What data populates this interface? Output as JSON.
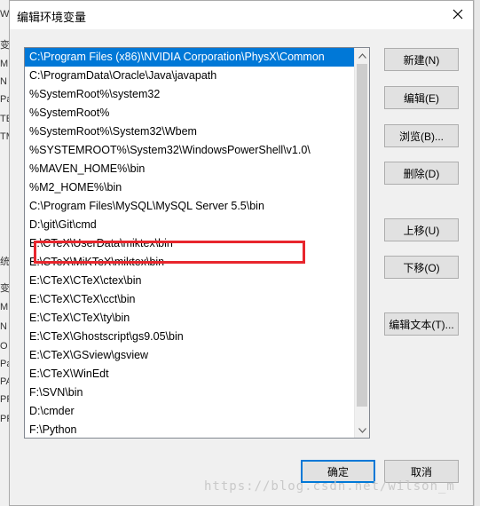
{
  "window": {
    "title": "编辑环境变量"
  },
  "paths": [
    "C:\\Program Files (x86)\\NVIDIA Corporation\\PhysX\\Common",
    "C:\\ProgramData\\Oracle\\Java\\javapath",
    "%SystemRoot%\\system32",
    "%SystemRoot%",
    "%SystemRoot%\\System32\\Wbem",
    "%SYSTEMROOT%\\System32\\WindowsPowerShell\\v1.0\\",
    "%MAVEN_HOME%\\bin",
    "%M2_HOME%\\bin",
    "C:\\Program Files\\MySQL\\MySQL Server 5.5\\bin",
    "D:\\git\\Git\\cmd",
    "E:\\CTeX\\UserData\\miktex\\bin",
    "E:\\CTeX\\MiKTeX\\miktex\\bin",
    "E:\\CTeX\\CTeX\\ctex\\bin",
    "E:\\CTeX\\CTeX\\cct\\bin",
    "E:\\CTeX\\CTeX\\ty\\bin",
    "E:\\CTeX\\Ghostscript\\gs9.05\\bin",
    "E:\\CTeX\\GSview\\gsview",
    "E:\\CTeX\\WinEdt",
    "F:\\SVN\\bin",
    "D:\\cmder",
    "F:\\Python"
  ],
  "buttons": {
    "new": "新建(N)",
    "edit": "编辑(E)",
    "browse": "浏览(B)...",
    "delete": "删除(D)",
    "move_up": "上移(U)",
    "move_down": "下移(O)",
    "edit_text": "编辑文本(T)...",
    "ok": "确定",
    "cancel": "取消"
  },
  "watermark": "https://blog.csdn.net/wilson_m",
  "background_fragments": [
    "W",
    "变",
    "M",
    "N",
    "Pa",
    "TE",
    "TM",
    "统",
    "变",
    "M",
    "N",
    "O",
    "Pa",
    "PA",
    "PF",
    "PF"
  ],
  "colors": {
    "selection": "#0078d7",
    "annotation_box": "#e8262d"
  }
}
